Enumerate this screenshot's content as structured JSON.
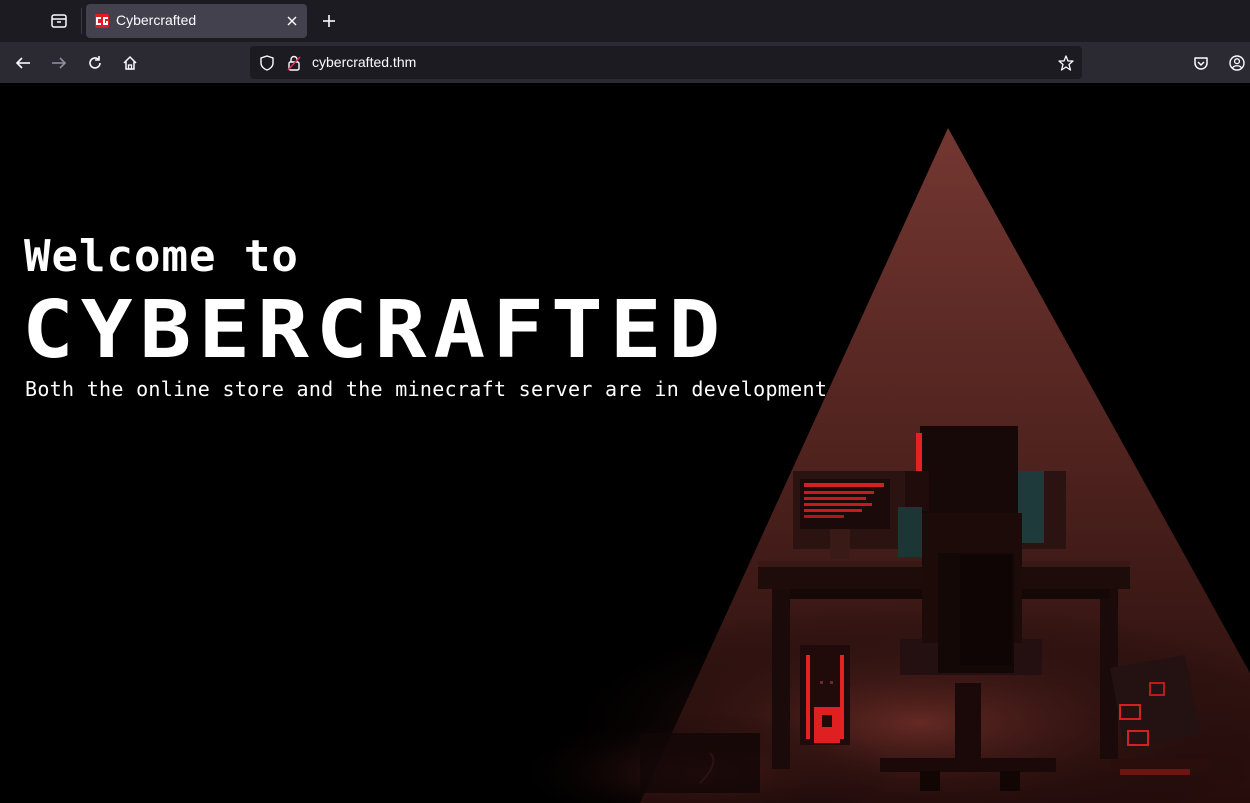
{
  "browser": {
    "tab": {
      "title": "Cybercrafted",
      "favicon_color": "#e01b24"
    },
    "url": "cybercrafted.thm",
    "theme": {
      "tabstrip_bg": "#1c1b22",
      "navbar_bg": "#2b2a33",
      "tab_active_bg": "#42414d"
    },
    "icons": [
      "tab-manager-icon",
      "close-icon",
      "plus-icon",
      "back-arrow-icon",
      "forward-arrow-icon",
      "reload-icon",
      "home-icon",
      "shield-icon",
      "lock-icon",
      "star-icon",
      "pocket-icon",
      "account-icon"
    ]
  },
  "page": {
    "welcome": "Welcome to",
    "brand": "CYBERCRAFTED",
    "tagline": "Both the online store and the minecraft server are in development",
    "accent_color": "#d42020",
    "background_color": "#000000"
  }
}
